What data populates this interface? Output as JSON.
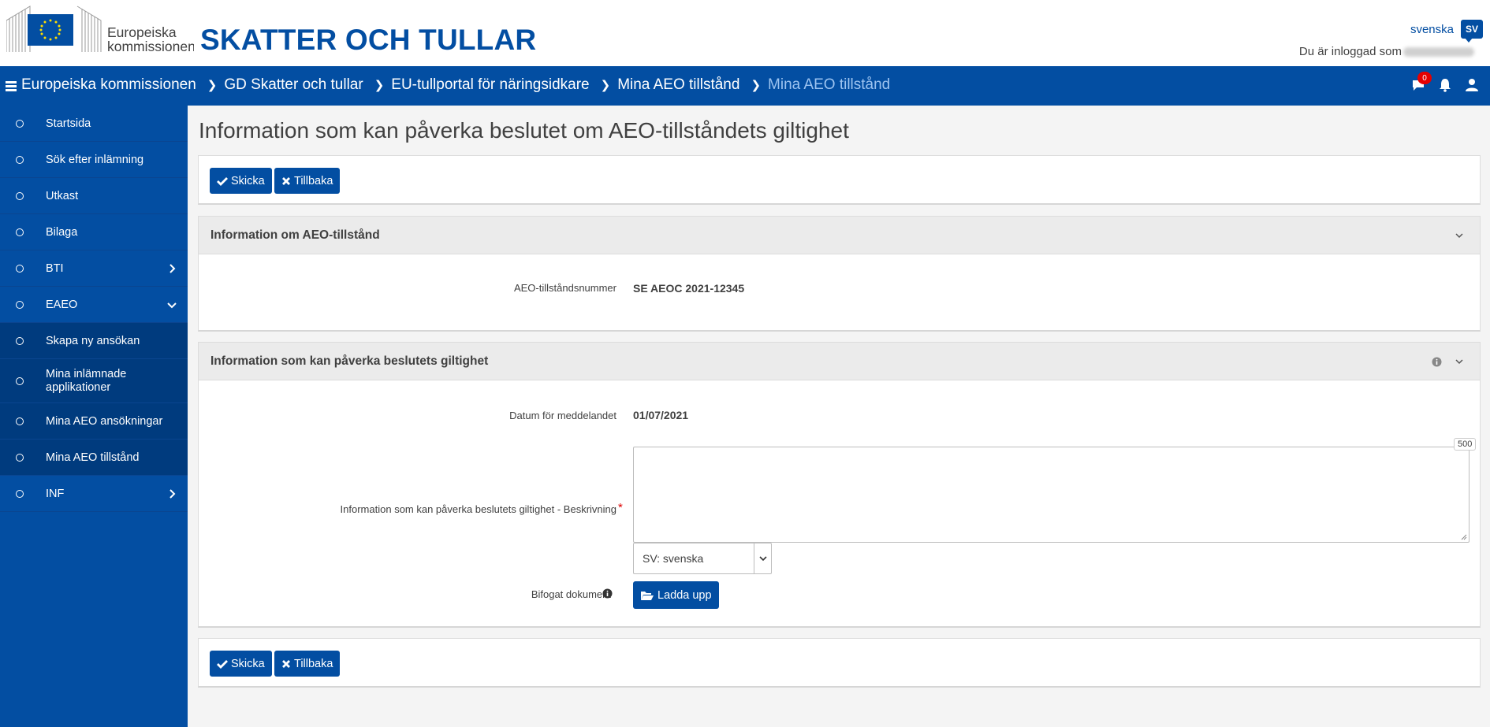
{
  "header": {
    "logo_text_line1": "Europeiska",
    "logo_text_line2": "kommissionen",
    "site_title": "SKATTER OCH TULLAR",
    "language_link": "svenska",
    "language_code": "SV",
    "login_prefix": "Du är inloggad som"
  },
  "breadcrumbs": [
    "Europeiska kommissionen",
    "GD Skatter och tullar",
    "EU-tullportal för näringsidkare",
    "Mina AEO tillstånd",
    "Mina AEO tillstånd"
  ],
  "navbar": {
    "notification_count": "0"
  },
  "sidebar": {
    "items": [
      {
        "label": "Startsida"
      },
      {
        "label": "Sök efter inlämning"
      },
      {
        "label": "Utkast"
      },
      {
        "label": "Bilaga"
      },
      {
        "label": "BTI"
      },
      {
        "label": "EAEO"
      },
      {
        "label": "Skapa ny ansökan"
      },
      {
        "label": "Mina inlämnade applikationer"
      },
      {
        "label": "Mina AEO ansökningar"
      },
      {
        "label": "Mina AEO tillstånd"
      },
      {
        "label": "INF"
      }
    ]
  },
  "main": {
    "title": "Information som kan påverka beslutet om AEO-tillståndets giltighet",
    "buttons": {
      "submit": "Skicka",
      "back": "Tillbaka",
      "upload": "Ladda upp"
    },
    "section1": {
      "title": "Information om AEO-tillstånd",
      "auth_label": "AEO-tillståndsnummer",
      "auth_value": "SE AEOC 2021-12345"
    },
    "section2": {
      "title": "Information som kan påverka beslutets giltighet",
      "date_label": "Datum för meddelandet",
      "date_value": "01/07/2021",
      "description_label": "Information som kan påverka beslutets giltighet - Beskrivning",
      "required_mark": "*",
      "char_limit": "500",
      "language_select": "SV: svenska",
      "attachment_label": "Bifogat dokument"
    }
  },
  "colors": {
    "primary": "#034ea2",
    "active_crumb": "#9cc3f0",
    "badge": "#e60000"
  }
}
